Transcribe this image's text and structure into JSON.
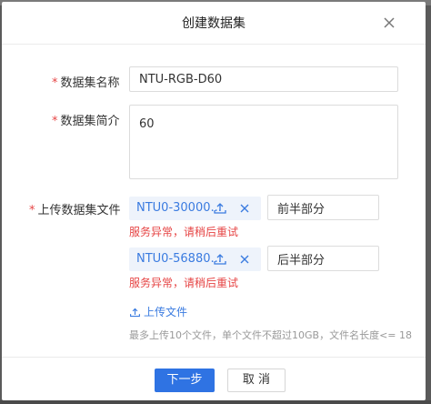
{
  "dialog": {
    "title": "创建数据集"
  },
  "form": {
    "name_label": "数据集名称",
    "name_value": "NTU-RGB-D60",
    "desc_label": "数据集简介",
    "desc_value": "60",
    "files_label": "上传数据集文件",
    "required_mark": "*",
    "files": [
      {
        "name": "NTU0-30000...",
        "error": "服务异常，请稍后重试",
        "part": "前半部分"
      },
      {
        "name": "NTU0-56880...",
        "error": "服务异常，请稍后重试",
        "part": "后半部分"
      }
    ],
    "upload_link": "上传文件",
    "hint": "最多上传10个文件，单个文件不超过10GB，文件名长度<= 18"
  },
  "footer": {
    "next_label": "下一步",
    "cancel_label": "取 消"
  },
  "colors": {
    "primary": "#2f73e3",
    "error": "#e64545",
    "link": "#3a7be0"
  }
}
